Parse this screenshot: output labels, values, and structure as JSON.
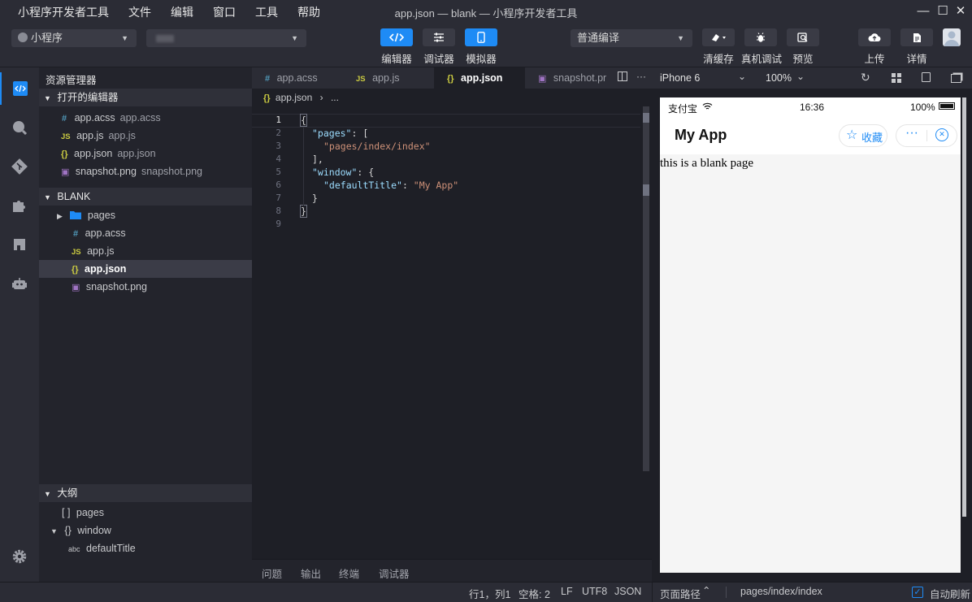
{
  "window": {
    "title": "app.json — blank — 小程序开发者工具"
  },
  "menu": {
    "items": [
      "小程序开发者工具",
      "文件",
      "编辑",
      "窗口",
      "工具",
      "帮助"
    ]
  },
  "toolbar": {
    "project_type": "小程序",
    "project_name": "",
    "editor_label": "编辑器",
    "debugger_label": "调试器",
    "simulator_label": "模拟器",
    "compile_mode": "普通编译",
    "clear_cache_label": "清缓存",
    "device_debug_label": "真机调试",
    "preview_label": "预览",
    "upload_label": "上传",
    "details_label": "详情"
  },
  "explorer": {
    "title": "资源管理器",
    "open_editors": {
      "header": "打开的编辑器",
      "items": [
        {
          "name": "app.acss",
          "path": "app.acss"
        },
        {
          "name": "app.js",
          "path": "app.js"
        },
        {
          "name": "app.json",
          "path": "app.json"
        },
        {
          "name": "snapshot.png",
          "path": "snapshot.png"
        }
      ]
    },
    "project": {
      "header": "BLANK",
      "items": [
        "pages",
        "app.acss",
        "app.js",
        "app.json",
        "snapshot.png"
      ]
    },
    "outline": {
      "header": "大纲",
      "items": [
        "pages",
        "window",
        "defaultTitle"
      ]
    }
  },
  "editor": {
    "tabs": [
      "app.acss",
      "app.js",
      "app.json",
      "snapshot.pn"
    ],
    "breadcrumb": {
      "file": "app.json",
      "rest": "..."
    },
    "line_numbers": [
      "1",
      "2",
      "3",
      "4",
      "5",
      "6",
      "7",
      "8",
      "9"
    ],
    "lines": {
      "l1": "{",
      "l2_key": "\"pages\"",
      "l2_rest": ": [",
      "l3_str": "\"pages/index/index\"",
      "l4": "],",
      "l5_key": "\"window\"",
      "l5_rest": ": {",
      "l6_key": "\"defaultTitle\"",
      "l6_sep": ": ",
      "l6_str": "\"My App\"",
      "l7": "}",
      "l8": "}"
    }
  },
  "panel": {
    "tabs": [
      "问题",
      "输出",
      "终端",
      "调试器"
    ]
  },
  "simulator": {
    "device": "iPhone 6",
    "zoom": "100%",
    "phone": {
      "carrier": "支付宝",
      "time": "16:36",
      "battery": "100%",
      "nav_title": "My App",
      "favorite_label": "收藏",
      "content": "this is a blank page"
    }
  },
  "status": {
    "position": "行1，列1",
    "indent": "空格: 2",
    "eol": "LF",
    "encoding": "UTF8",
    "language": "JSON",
    "page_path_label": "页面路径",
    "page_path": "pages/index/index",
    "auto_refresh_label": "自动刷新"
  },
  "colors": {
    "accent": "#1e8bf5",
    "background": "#25262e",
    "editor": "#1e1f26"
  }
}
